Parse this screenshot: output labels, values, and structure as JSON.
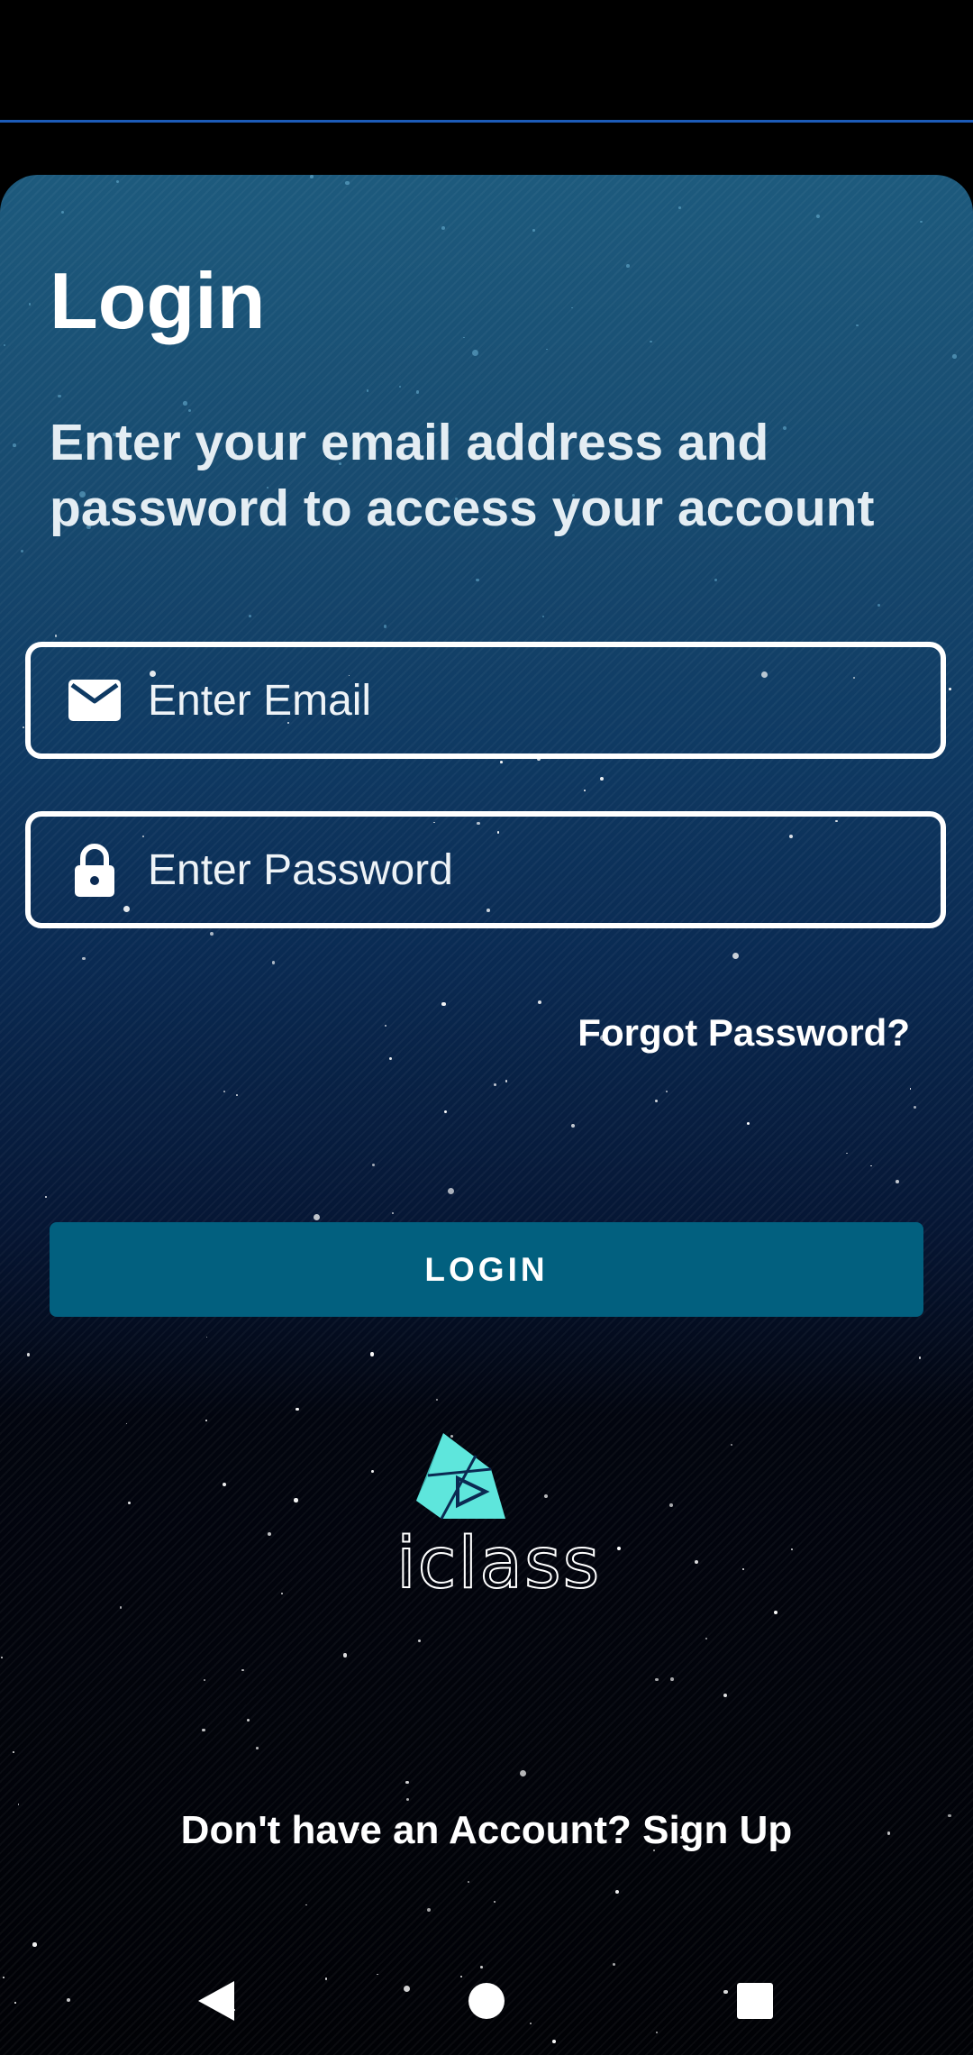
{
  "header": {
    "title": "Login",
    "subtitle": "Enter your email address and password to access your account"
  },
  "form": {
    "email": {
      "placeholder": "Enter Email",
      "icon": "mail-icon"
    },
    "password": {
      "placeholder": "Enter Password",
      "icon": "lock-icon"
    },
    "forgot_label": "Forgot Password?",
    "login_label": "LOGIN"
  },
  "logo": {
    "text": "iclass",
    "accent": "#5ee6dc"
  },
  "footer": {
    "signup_text": "Don't have an Account? Sign Up"
  },
  "navigation": {
    "back": "back-icon",
    "home": "home-icon",
    "recents": "recents-icon"
  },
  "colors": {
    "button": "#02607f",
    "divider": "#1c5bb8"
  }
}
